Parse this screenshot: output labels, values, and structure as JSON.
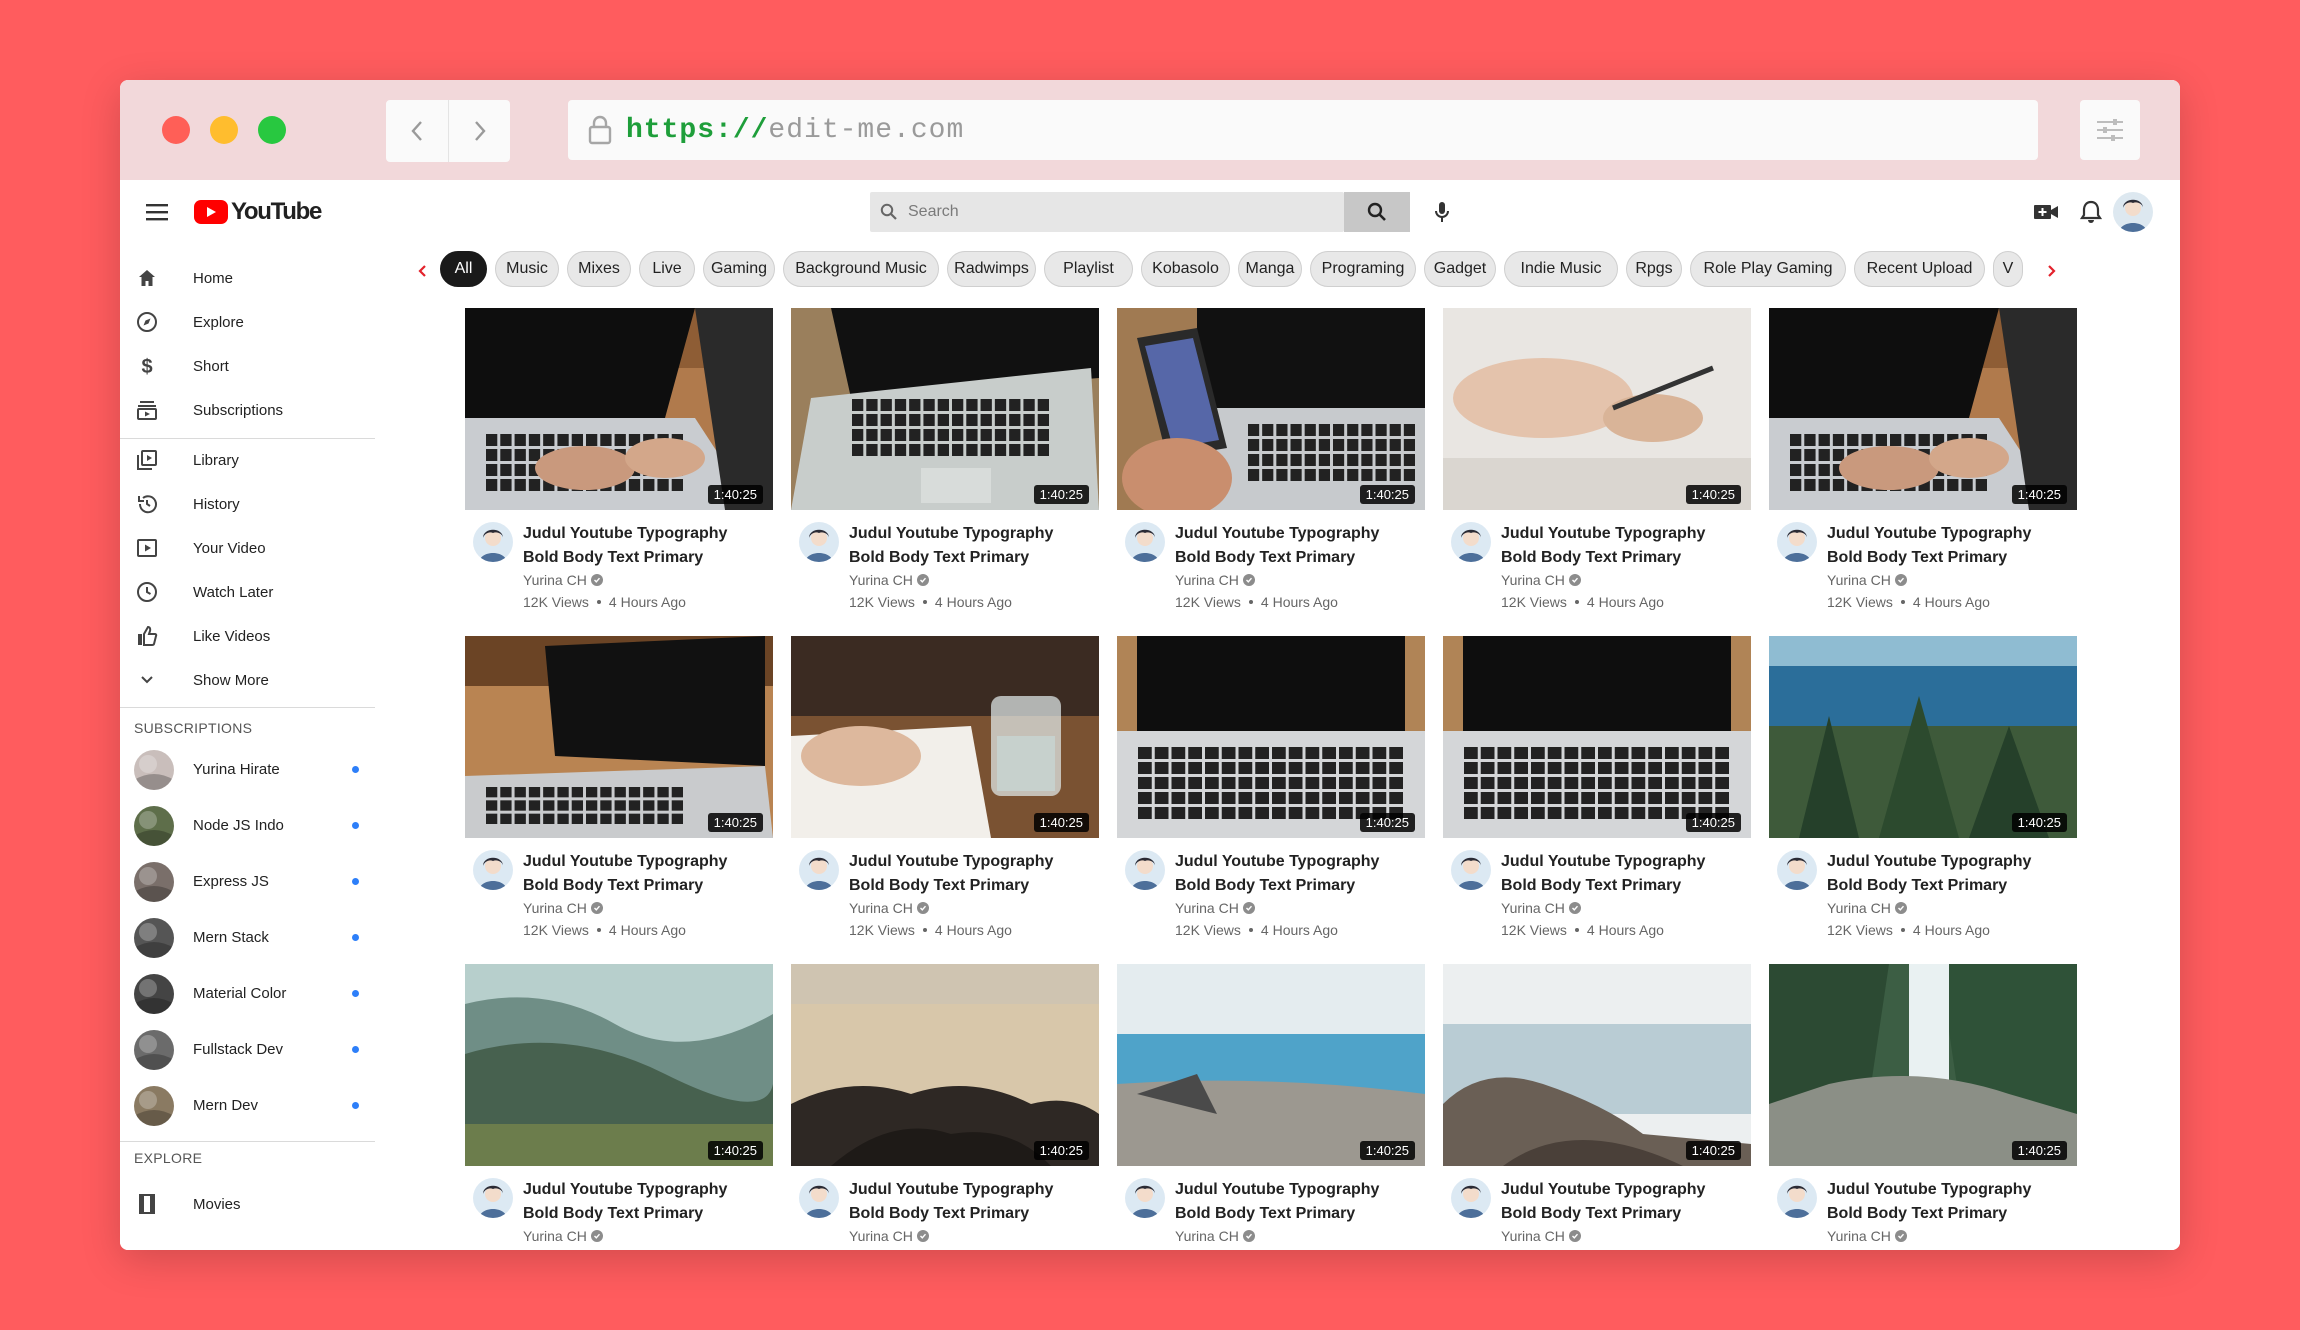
{
  "browser": {
    "url_protocol": "https://",
    "url_host": "edit-me.com"
  },
  "header": {
    "logo_text": "YouTube",
    "search_placeholder": "Search"
  },
  "sidebar": {
    "main": [
      {
        "label": "Home",
        "icon": "home-icon"
      },
      {
        "label": "Explore",
        "icon": "compass-icon"
      },
      {
        "label": "Short",
        "icon": "dollar-icon"
      },
      {
        "label": "Subscriptions",
        "icon": "subscriptions-icon"
      }
    ],
    "library": [
      {
        "label": "Library",
        "icon": "library-icon"
      },
      {
        "label": "History",
        "icon": "history-icon"
      },
      {
        "label": "Your Video",
        "icon": "play-square-icon"
      },
      {
        "label": "Watch Later",
        "icon": "clock-icon"
      },
      {
        "label": "Like Videos",
        "icon": "thumbs-up-icon"
      },
      {
        "label": "Show More",
        "icon": "chevron-down-icon"
      }
    ],
    "subscriptions_heading": "SUBSCRIPTIONS",
    "subscriptions": [
      {
        "label": "Yurina Hirate",
        "color": "#C9BEBB"
      },
      {
        "label": "Node JS Indo",
        "color": "#5E6E4A"
      },
      {
        "label": "Express JS",
        "color": "#7A6F6A"
      },
      {
        "label": "Mern Stack",
        "color": "#555555"
      },
      {
        "label": "Material Color",
        "color": "#444444"
      },
      {
        "label": "Fullstack Dev",
        "color": "#6B6B6B"
      },
      {
        "label": "Mern Dev",
        "color": "#8A7A62"
      }
    ],
    "explore_heading": "EXPLORE",
    "explore": [
      {
        "label": "Movies",
        "icon": "film-icon"
      }
    ]
  },
  "chips": [
    "All",
    "Music",
    "Mixes",
    "Live",
    "Gaming",
    "Background Music",
    "Radwimps",
    "Playlist",
    "Kobasolo",
    "Manga",
    "Programing",
    "Gadget",
    "Indie Music",
    "Rpgs",
    "Role Play Gaming",
    "Recent Upload",
    "V"
  ],
  "video_defaults": {
    "title_line1": "Judul Youtube Typography",
    "title_line2": "Bold Body Text Primary",
    "channel": "Yurina CH",
    "views": "12K Views",
    "age": "4 Hours Ago",
    "duration": "1:40:25"
  },
  "videos": [
    {
      "thumb": "laptop-typing"
    },
    {
      "thumb": "laptop-open"
    },
    {
      "thumb": "phone-laptop"
    },
    {
      "thumb": "hand-writing"
    },
    {
      "thumb": "laptop-typing"
    },
    {
      "thumb": "laptop-side"
    },
    {
      "thumb": "notebook-glass"
    },
    {
      "thumb": "laptop-front"
    },
    {
      "thumb": "laptop-front"
    },
    {
      "thumb": "lake-forest"
    },
    {
      "thumb": "misty-forest"
    },
    {
      "thumb": "beach-rocks"
    },
    {
      "thumb": "sea-shore"
    },
    {
      "thumb": "rocky-coast"
    },
    {
      "thumb": "waterfall"
    }
  ]
}
